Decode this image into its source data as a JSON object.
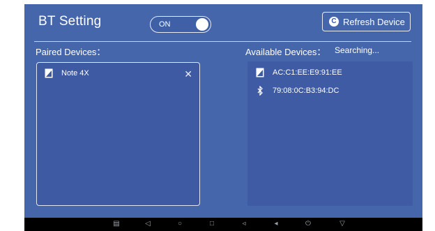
{
  "header": {
    "title": "BT Setting",
    "toggle_label": "ON",
    "refresh_label": "Refresh Device"
  },
  "paired": {
    "label": "Paired Devices：",
    "devices": [
      {
        "name": "Note 4X",
        "icon": "phone-icon"
      }
    ]
  },
  "available": {
    "label": "Available Devices：",
    "status": "Searching...",
    "devices": [
      {
        "name": "AC:C1:EE:E9:91:EE",
        "icon": "phone-icon"
      },
      {
        "name": "79:08:0C:B3:94:DC",
        "icon": "bluetooth-icon"
      }
    ]
  },
  "navbar": {
    "icons": [
      "screenshot-icon",
      "back-icon",
      "home-icon",
      "recents-icon",
      "volume-down-icon",
      "volume-up-icon",
      "power-icon",
      "menu-down-icon"
    ]
  },
  "colors": {
    "background": "#4566ab",
    "panel": "#3d5aa3",
    "navbar": "#000000"
  }
}
